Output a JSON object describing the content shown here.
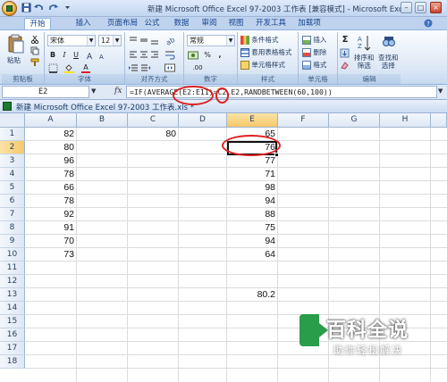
{
  "window": {
    "title": "新建 Microsoft Office Excel 97-2003 工作表 [兼容模式] - Microsoft Excel",
    "minimize": "–",
    "maximize": "□",
    "close": "×"
  },
  "ribbon_tabs": [
    "开始",
    "插入",
    "页面布局",
    "公式",
    "数据",
    "审阅",
    "视图",
    "开发工具",
    "加载项"
  ],
  "ribbon": {
    "clipboard": {
      "paste": "粘贴",
      "label": "剪贴板"
    },
    "font": {
      "name": "宋体",
      "size": "12",
      "bold": "B",
      "italic": "I",
      "underline": "U",
      "label": "字体",
      "font_color": "A"
    },
    "alignment": {
      "label": "对齐方式"
    },
    "number": {
      "format": "常规",
      "label": "数字",
      "currency": "%",
      "comma": ",",
      "inc_dec": ".00"
    },
    "styles": {
      "conditional": "条件格式",
      "table": "套用表格格式",
      "cell": "单元格样式",
      "label": "样式"
    },
    "cells": {
      "insert": "插入",
      "delete": "删除",
      "format": "格式",
      "label": "单元格"
    },
    "editing": {
      "sum": "Σ",
      "sort": "排序和\n筛选",
      "find": "查找和\n选择",
      "sort_1": "排序和",
      "sort_2": "筛选",
      "find_1": "查找和",
      "find_2": "选择",
      "label": "编辑"
    }
  },
  "formula_bar": {
    "name_box": "E2",
    "fx": "fx",
    "formula": "=IF(AVERAGE(E2:E11)=C2,E2,RANDBETWEEN(60,100))"
  },
  "workbook": {
    "name": "新建 Microsoft Office Excel 97-2003 工作表.xls *"
  },
  "grid": {
    "columns": [
      "A",
      "B",
      "C",
      "D",
      "E",
      "F",
      "G",
      "H"
    ],
    "rows": [
      "1",
      "2",
      "3",
      "4",
      "5",
      "6",
      "7",
      "8",
      "9",
      "10",
      "11",
      "12",
      "13",
      "14",
      "15",
      "16",
      "17",
      "18"
    ],
    "active_cell": "E2",
    "col_a": [
      "82",
      "80",
      "96",
      "78",
      "66",
      "78",
      "92",
      "91",
      "70",
      "73"
    ],
    "c1": "80",
    "col_e": [
      "65",
      "76",
      "77",
      "71",
      "98",
      "94",
      "88",
      "75",
      "94",
      "64"
    ],
    "e13": "80.2"
  },
  "watermark": {
    "title": "百科全说",
    "subtitle": "助你轻松解决"
  },
  "annotation_color": "#e02020"
}
